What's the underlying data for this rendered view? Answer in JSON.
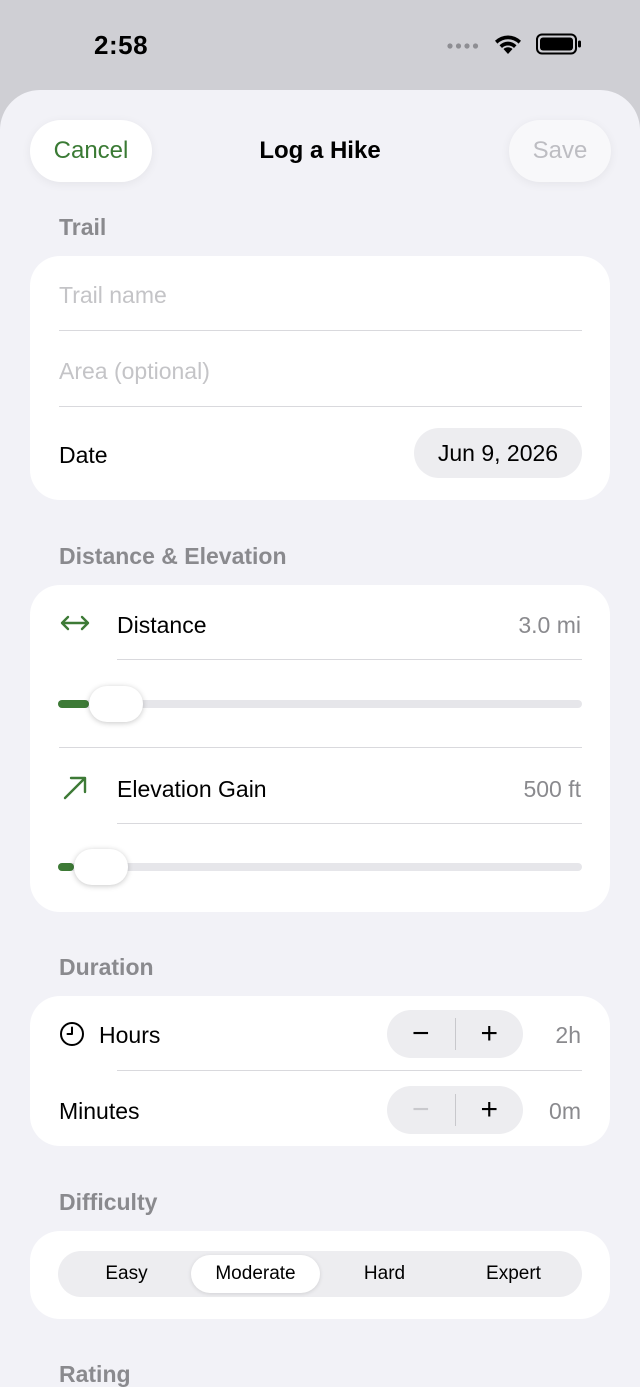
{
  "status_bar": {
    "time": "2:58"
  },
  "nav": {
    "cancel_label": "Cancel",
    "title": "Log a Hike",
    "save_label": "Save"
  },
  "sections": {
    "trail": "Trail",
    "distance_elevation": "Distance & Elevation",
    "duration": "Duration",
    "difficulty": "Difficulty",
    "rating": "Rating"
  },
  "trail": {
    "name_placeholder": "Trail name",
    "area_placeholder": "Area (optional)",
    "date_label": "Date",
    "date_value": "Jun 9, 2026"
  },
  "distance": {
    "label": "Distance",
    "value": "3.0 mi",
    "slider_fraction": 0.06,
    "icon": "left-right-arrow-icon"
  },
  "elevation": {
    "label": "Elevation Gain",
    "value": "500 ft",
    "slider_fraction": 0.03,
    "icon": "arrow-up-right-icon"
  },
  "duration": {
    "hours_label": "Hours",
    "hours_value": "2h",
    "hours_icon": "clock-icon",
    "minutes_label": "Minutes",
    "minutes_value": "0m",
    "minus": "−",
    "plus": "+"
  },
  "difficulty": {
    "options": [
      "Easy",
      "Moderate",
      "Hard",
      "Expert"
    ],
    "selected": "Moderate"
  },
  "colors": {
    "accent": "#3d7a36",
    "background": "#f2f2f7",
    "card": "#ffffff"
  }
}
